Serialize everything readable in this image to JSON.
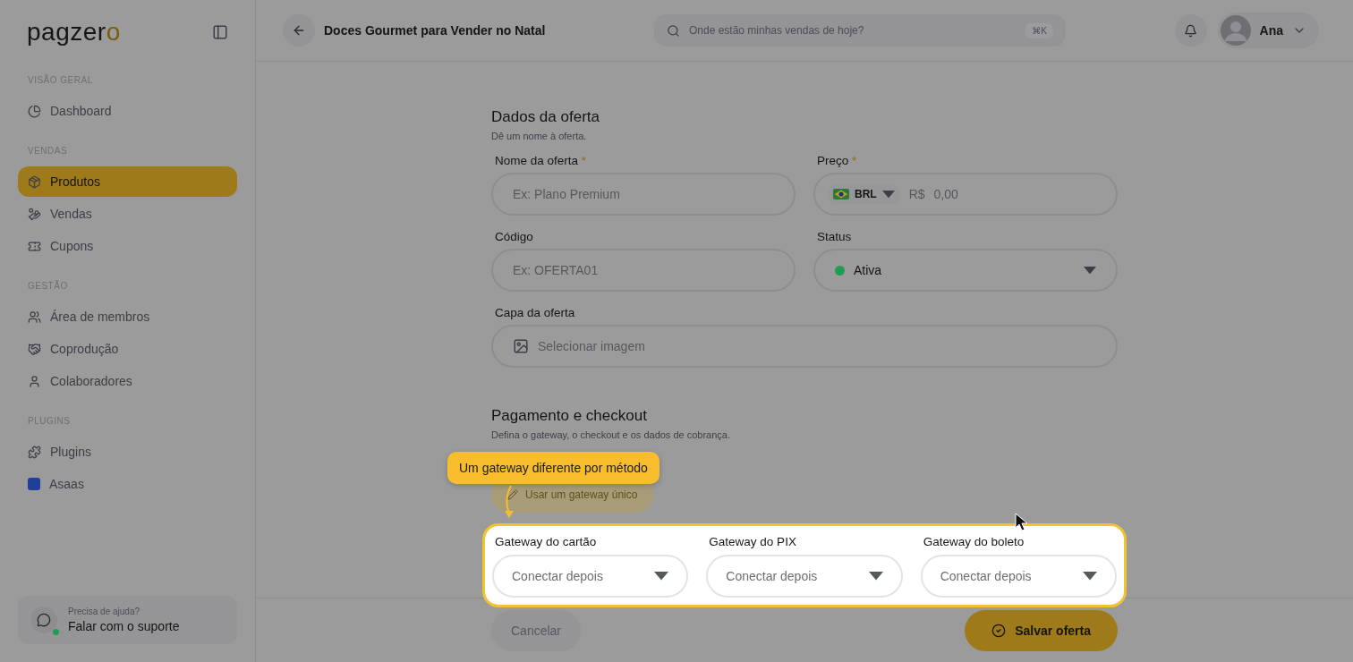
{
  "sidebar": {
    "logo": "pagzero",
    "sections": [
      {
        "title": "VISÃO GERAL",
        "items": [
          {
            "label": "Dashboard",
            "selected": false
          }
        ]
      },
      {
        "title": "VENDAS",
        "items": [
          {
            "label": "Produtos",
            "selected": true
          },
          {
            "label": "Vendas",
            "selected": false
          },
          {
            "label": "Cupons",
            "selected": false
          }
        ]
      },
      {
        "title": "GESTÃO",
        "items": [
          {
            "label": "Área de membros",
            "selected": false
          },
          {
            "label": "Coprodução",
            "selected": false
          },
          {
            "label": "Colaboradores",
            "selected": false
          }
        ]
      },
      {
        "title": "PLUGINS",
        "items": [
          {
            "label": "Plugins",
            "selected": false
          },
          {
            "label": "Asaas",
            "selected": false
          }
        ]
      }
    ],
    "support": {
      "caption": "Precisa de ajuda?",
      "label": "Falar com o suporte",
      "online": true
    }
  },
  "topbar": {
    "title": "Doces Gourmet para Vender no Natal",
    "search": {
      "placeholder": "Onde estão minhas vendas de hoje?",
      "shortcut": "⌘K"
    },
    "user": "Ana"
  },
  "offer": {
    "title": "Dados da oferta",
    "subtitle": "Dê um nome à oferta.",
    "fields": [
      {
        "kind": "text",
        "label": "Nome da oferta",
        "required_mark": "*",
        "placeholder": "Ex: Plano Premium"
      },
      {
        "kind": "price",
        "label": "Preço",
        "required_mark": "*",
        "currency": "BRL",
        "symbol": "R$",
        "placeholder": "0,00"
      },
      {
        "kind": "text",
        "label": "Código",
        "placeholder": "Ex: OFERTA01"
      },
      {
        "kind": "status",
        "label": "Status",
        "value": "Ativa",
        "color": "#1f9d55"
      },
      {
        "kind": "image",
        "label": "Capa da oferta",
        "placeholder": "Selecionar imagem"
      }
    ]
  },
  "payment": {
    "title": "Pagamento e checkout",
    "subtitle": "Defina o gateway, o checkout e os dados de cobrança.",
    "toggle_button": "Usar um gateway único",
    "gateways": [
      {
        "label": "Gateway do cartão",
        "placeholder": "Conectar depois"
      },
      {
        "label": "Gateway do PIX",
        "placeholder": "Conectar depois"
      },
      {
        "label": "Gateway do boleto",
        "placeholder": "Conectar depois"
      }
    ]
  },
  "tour_tip": "Um gateway diferente por método",
  "footer": {
    "cancel": "Cancelar",
    "save": "Salvar oferta"
  }
}
